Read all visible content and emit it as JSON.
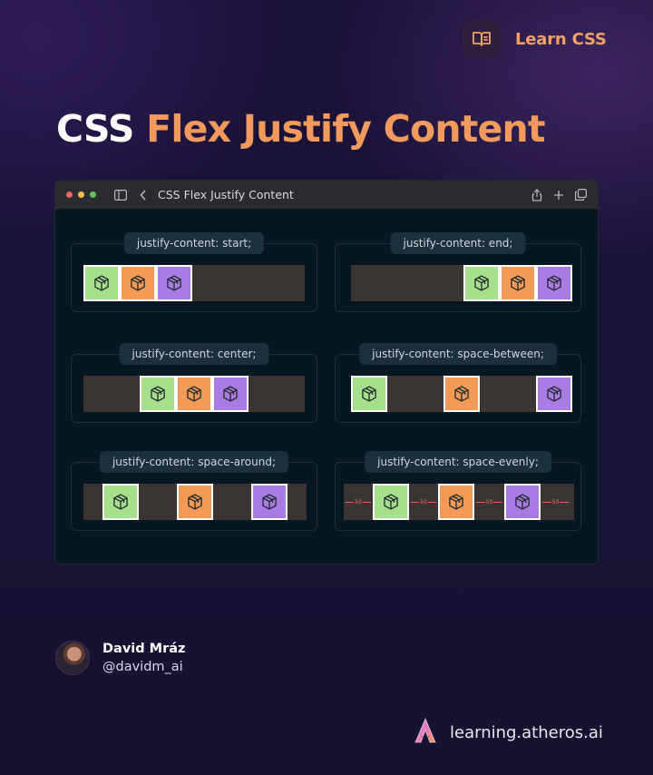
{
  "header": {
    "badge_icon": "book-icon",
    "badge_label_a": "Learn ",
    "badge_label_b": "CSS"
  },
  "headline": {
    "white": "CSS ",
    "orange": "Flex Justify Content"
  },
  "window": {
    "title": "CSS Flex Justify Content",
    "dots": [
      "#ee6a5e",
      "#f5bd4f",
      "#61c454"
    ]
  },
  "demos": [
    {
      "label": "justify-content: start;",
      "justify": "flex-start"
    },
    {
      "label": "justify-content: end;",
      "justify": "flex-end"
    },
    {
      "label": "justify-content: center;",
      "justify": "center"
    },
    {
      "label": "justify-content: space-between;",
      "justify": "space-between"
    },
    {
      "label": "justify-content: space-around;",
      "justify": "space-around"
    },
    {
      "label": "justify-content: space-evenly;",
      "justify": "space-evenly"
    }
  ],
  "box_colors": {
    "green": "#a6e08d",
    "orange": "#f29a56",
    "purple": "#a97be4"
  },
  "gap_label": "50",
  "author": {
    "name": "David Mráz",
    "handle": "@davidm_ai"
  },
  "brand": {
    "name": "learning.atheros.ai",
    "logo": "atheros-logo"
  }
}
